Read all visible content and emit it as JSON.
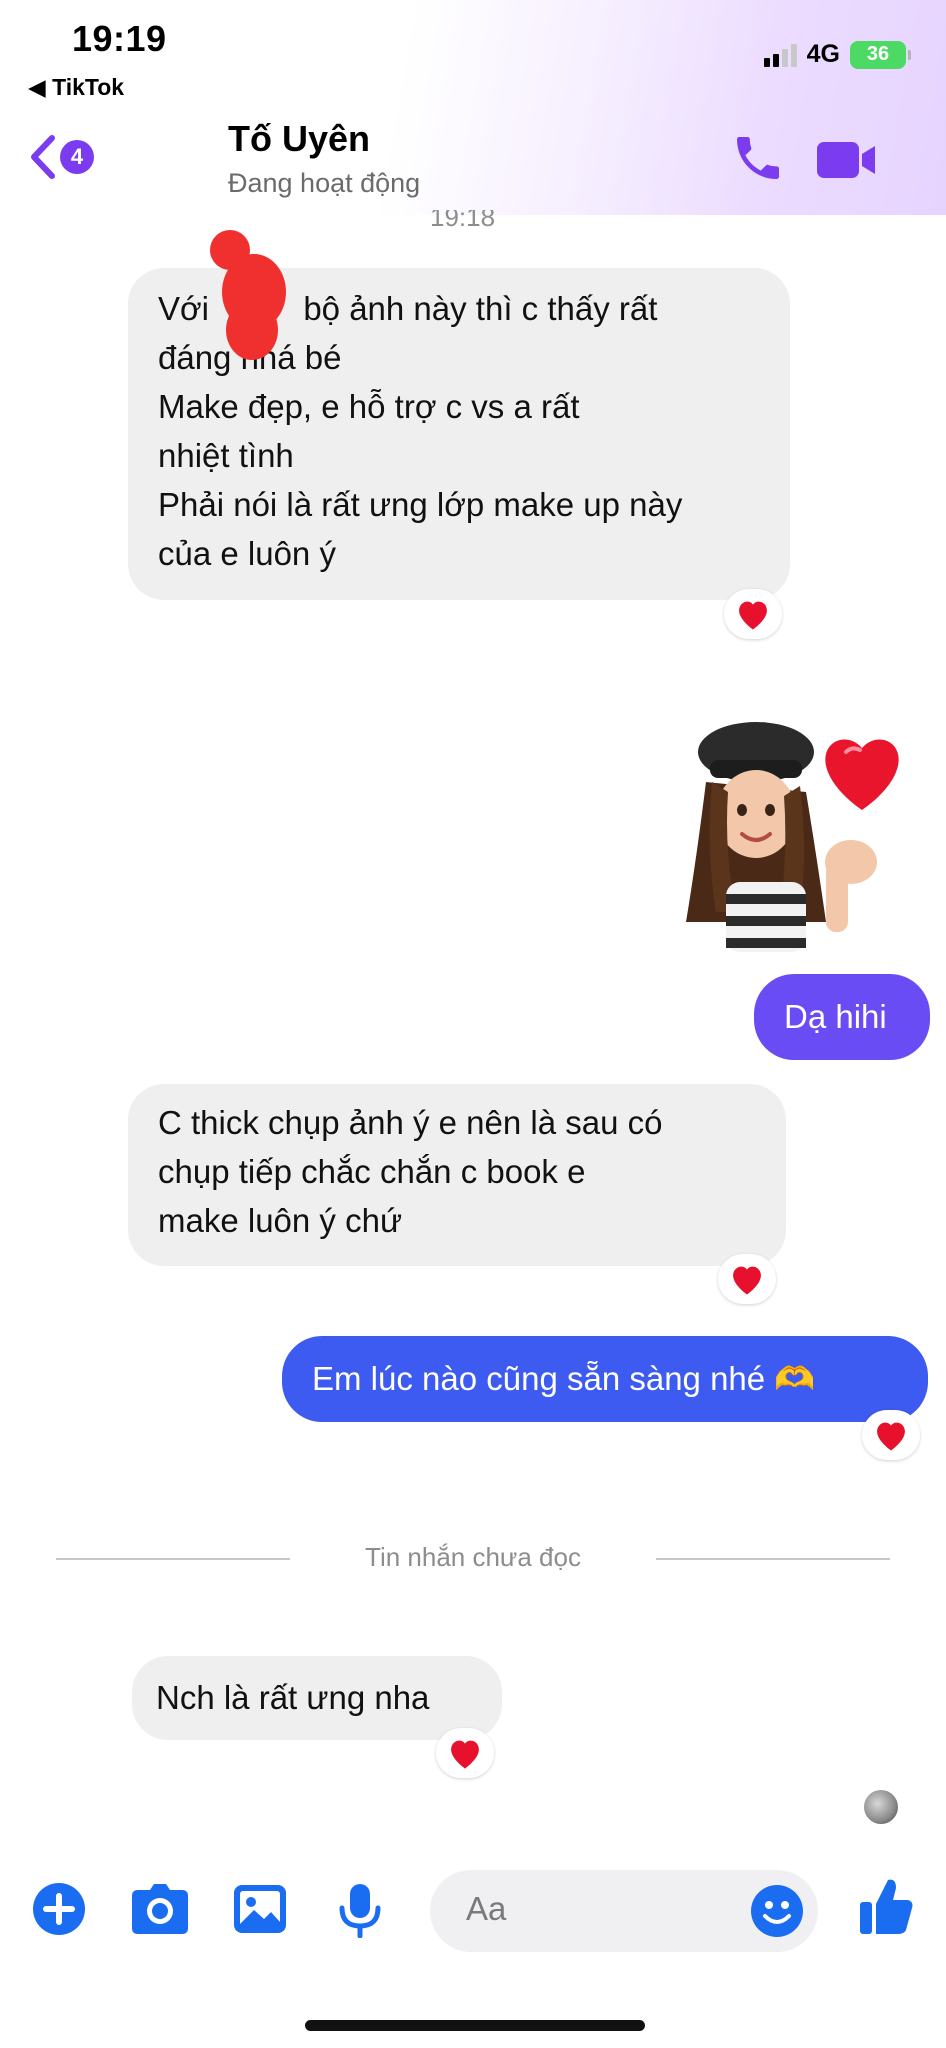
{
  "status_bar": {
    "time": "19:19",
    "back_app": "◀ TikTok",
    "network": "4G",
    "battery": "36"
  },
  "header": {
    "unread_count": "4",
    "contact_name": "Tố Uyên",
    "contact_status": "Đang hoạt động"
  },
  "conversation": {
    "timestamp": "19:18",
    "msg1_line1_pre": "Với",
    "msg1_line1_post": "bộ ảnh này thì c thấy rất",
    "msg1_rest": [
      "đáng nhá bé",
      "Make đẹp, e hỗ trợ c vs a rất",
      "nhiệt tình",
      "Phải nói là rất ưng lớp make up này",
      "của e luôn ý"
    ],
    "msg2": "Dạ hihi",
    "msg3": [
      "C thick chụp ảnh ý e nên là sau có",
      "chụp tiếp chắc chắn c book e",
      "make luôn ý chứ"
    ],
    "msg4": "Em lúc nào cũng sẵn sàng nhé 🫶",
    "unread_divider": "Tin nhắn chưa đọc",
    "msg5": "Nch là rất ưng nha"
  },
  "composer": {
    "placeholder": "Aa"
  },
  "colors": {
    "accent_purple": "#7b3cf0",
    "bubble_violet": "#6a4cf4",
    "bubble_blue": "#3d5af1",
    "composer_blue": "#1a6cf0",
    "incoming_bubble": "#efefef"
  },
  "icons": [
    "back-chevron-icon",
    "phone-icon",
    "video-camera-icon",
    "heart-reaction-icon",
    "plus-icon",
    "camera-icon",
    "image-icon",
    "microphone-icon",
    "emoji-icon",
    "thumbs-up-icon",
    "sticker-avatar-heart"
  ]
}
